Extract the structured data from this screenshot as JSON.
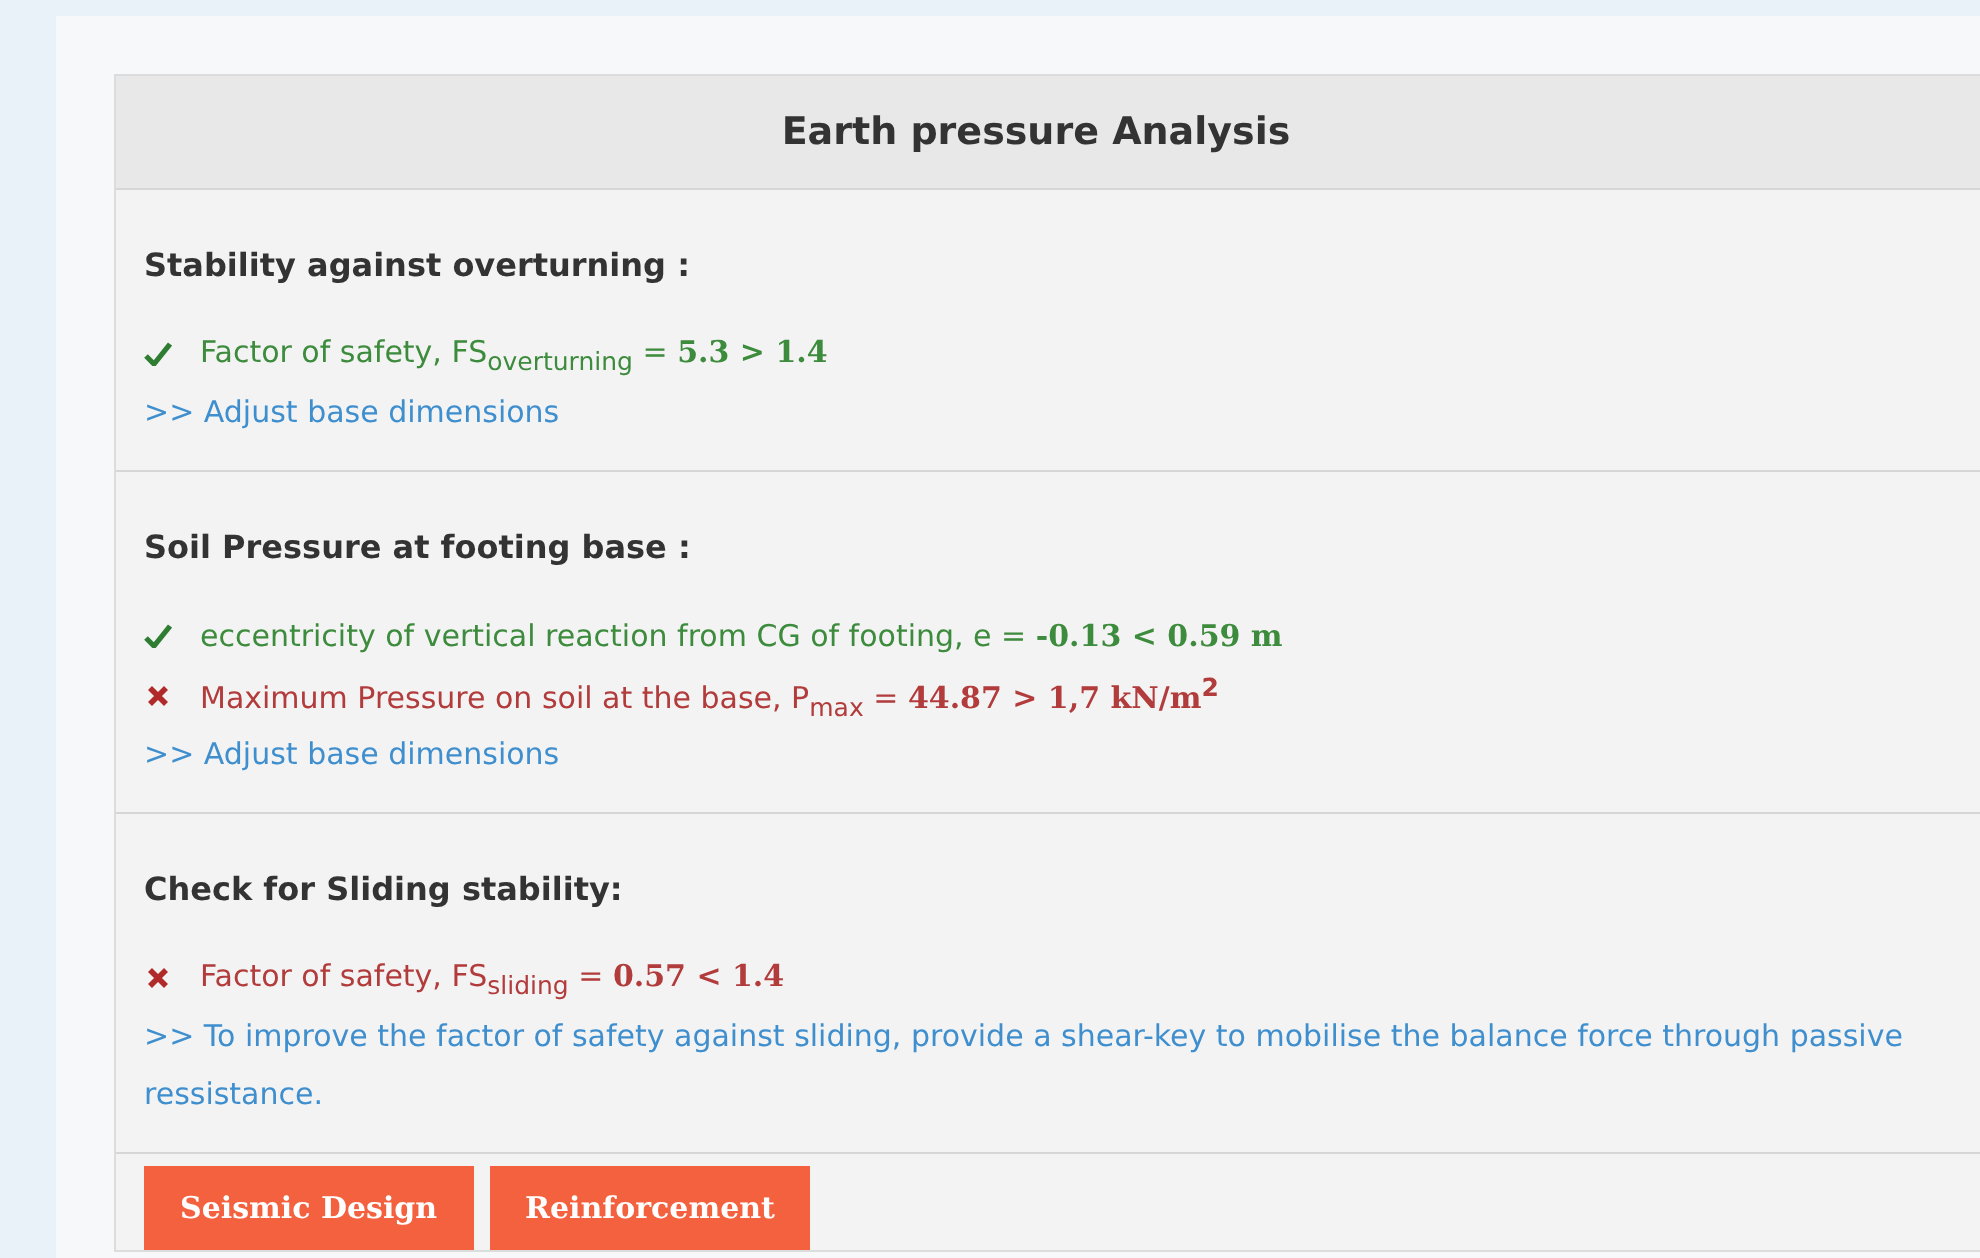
{
  "title": "Earth pressure Analysis",
  "sections": [
    {
      "heading": "Stability against overturning :",
      "checks": [
        {
          "passed": true,
          "text": "Factor of safety, FS$_{overturning}$ = **5.3 > 1.4**"
        }
      ],
      "advice": ">> Adjust base dimensions"
    },
    {
      "heading": "Soil Pressure at footing base :",
      "checks": [
        {
          "passed": true,
          "text": "eccentricity of vertical reaction from CG of footing, e = **-0.13 < 0.59 m**"
        },
        {
          "passed": false,
          "text": "Maximum Pressure on soil at the base, P$_{max}$ = **44.87 > 1,7 kN/m**$^{2}$"
        }
      ],
      "advice": ">> Adjust base dimensions"
    },
    {
      "heading": "Check for Sliding stability:",
      "checks": [
        {
          "passed": false,
          "text": "Factor of safety, FS$_{sliding}$ = **0.57 < 1.4**"
        }
      ],
      "advice": ">> To improve the factor of safety against sliding, provide a shear-key to mobilise the balance force through passive ressistance."
    }
  ],
  "buttons": [
    "Seismic Design",
    "Reinforcement"
  ]
}
